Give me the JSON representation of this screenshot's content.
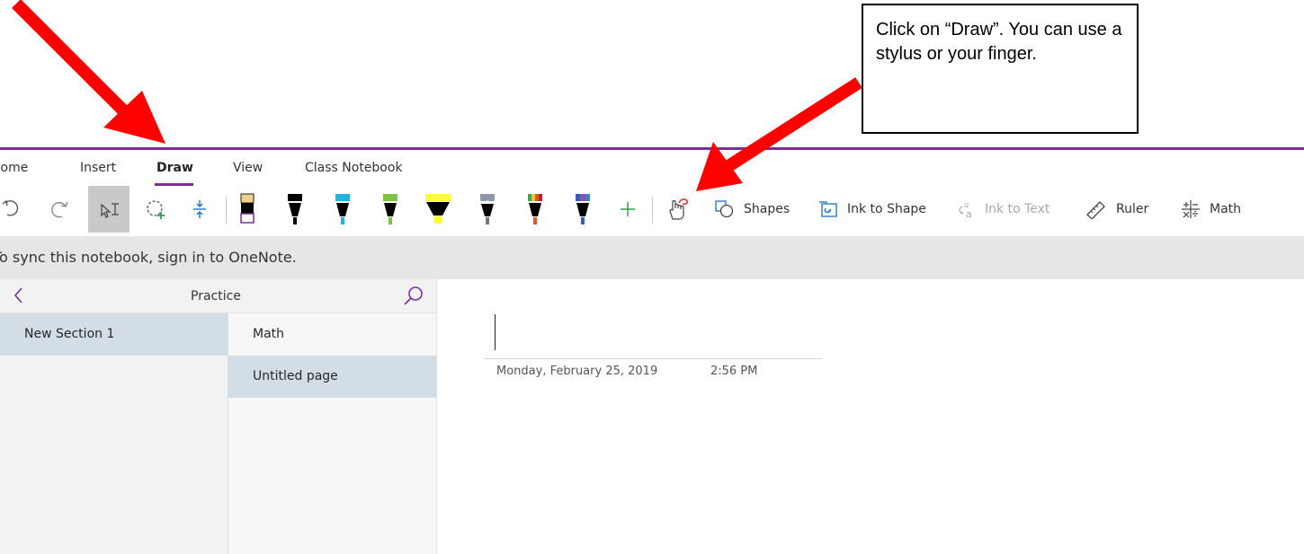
{
  "tabs": [
    {
      "label": "Home",
      "active": false
    },
    {
      "label": "Insert",
      "active": false
    },
    {
      "label": "Draw",
      "active": true
    },
    {
      "label": "View",
      "active": false
    },
    {
      "label": "Class Notebook",
      "active": false
    }
  ],
  "toolbar": {
    "pens": [
      {
        "name": "pencil-black",
        "color": "#000000",
        "tip": "#f0d08a"
      },
      {
        "name": "pen-black",
        "color": "#000000"
      },
      {
        "name": "pen-cyan",
        "color": "#22b0e6"
      },
      {
        "name": "pen-green",
        "color": "#7ec241"
      },
      {
        "name": "highlighter-yellow",
        "color": "#ffff33"
      },
      {
        "name": "pen-galaxy",
        "color": "#7a8a9a"
      },
      {
        "name": "pen-rainbow",
        "color": "#e05a20"
      },
      {
        "name": "pen-cosmic",
        "color": "#3a5ab8"
      }
    ],
    "shapes_label": "Shapes",
    "ink_to_shape_label": "Ink to Shape",
    "ink_to_text_label": "Ink to Text",
    "ruler_label": "Ruler",
    "math_label": "Math"
  },
  "sync_message": "To sync this notebook, sign in to OneNote.",
  "notebook": {
    "title": "Practice",
    "sections": [
      {
        "label": "New Section 1",
        "selected": true
      }
    ],
    "pages": [
      {
        "label": "Math",
        "selected": false
      },
      {
        "label": "Untitled page",
        "selected": true
      }
    ]
  },
  "page": {
    "date": "Monday, February 25, 2019",
    "time": "2:56 PM"
  },
  "callout": {
    "text": "Click on “Draw”. You can use a stylus or your finger."
  },
  "colors": {
    "accent": "#7b2e9a",
    "arrow": "#ff0000",
    "selected_item": "#d3dde6"
  }
}
